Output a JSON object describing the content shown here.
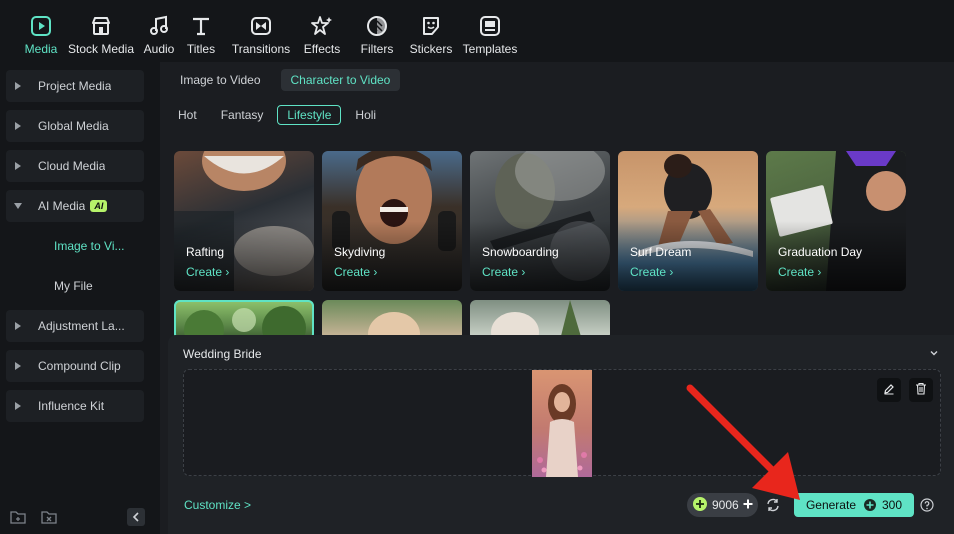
{
  "toolbar": {
    "items": [
      {
        "label": "Media",
        "icon": "media-icon",
        "active": true
      },
      {
        "label": "Stock Media",
        "icon": "stock-media-icon"
      },
      {
        "label": "Audio",
        "icon": "audio-icon"
      },
      {
        "label": "Titles",
        "icon": "titles-icon"
      },
      {
        "label": "Transitions",
        "icon": "transitions-icon"
      },
      {
        "label": "Effects",
        "icon": "effects-icon"
      },
      {
        "label": "Filters",
        "icon": "filters-icon"
      },
      {
        "label": "Stickers",
        "icon": "stickers-icon"
      },
      {
        "label": "Templates",
        "icon": "templates-icon"
      }
    ]
  },
  "sidebar": {
    "items": [
      {
        "label": "Project Media"
      },
      {
        "label": "Global Media"
      },
      {
        "label": "Cloud Media"
      },
      {
        "label": "AI Media",
        "badge": "AI"
      },
      {
        "label": "Adjustment La..."
      },
      {
        "label": "Compound Clip"
      },
      {
        "label": "Influence Kit"
      }
    ],
    "sub_items": [
      {
        "label": "Image to Vi...",
        "active": true
      },
      {
        "label": "My File"
      }
    ]
  },
  "tabs": [
    {
      "label": "Image to Video"
    },
    {
      "label": "Character to Video",
      "active": true
    }
  ],
  "categories": [
    {
      "label": "Hot"
    },
    {
      "label": "Fantasy"
    },
    {
      "label": "Lifestyle",
      "active": true
    },
    {
      "label": "Holi"
    }
  ],
  "cards": [
    {
      "title": "Rafting",
      "create": "Create"
    },
    {
      "title": "Skydiving",
      "create": "Create"
    },
    {
      "title": "Snowboarding",
      "create": "Create"
    },
    {
      "title": "Surf Dream",
      "create": "Create"
    },
    {
      "title": "Graduation Day",
      "create": "Create"
    }
  ],
  "panel": {
    "title": "Wedding Bride",
    "customize": "Customize >",
    "credits": "9006",
    "generate": "Generate",
    "cost": "300"
  },
  "colors": {
    "accent": "#5fe3c5",
    "ai_badge": "#b6f36a",
    "annotation_arrow": "#e8261c"
  }
}
